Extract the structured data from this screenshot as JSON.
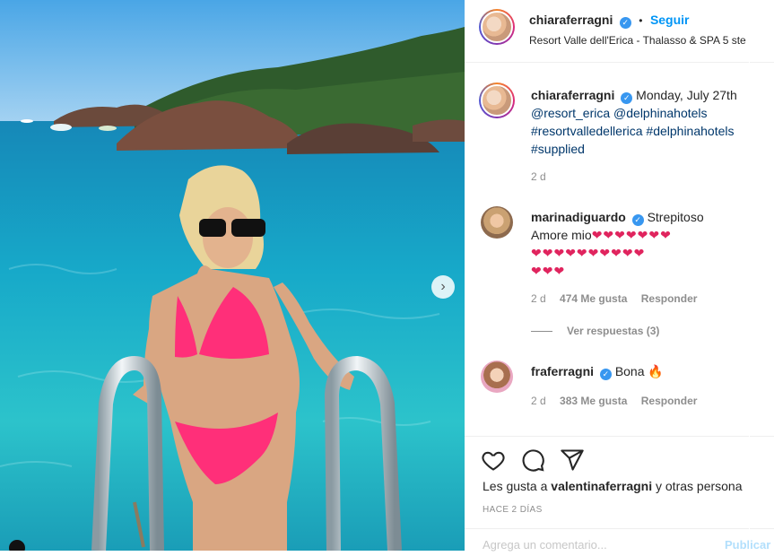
{
  "post": {
    "author": "chiaraferragni",
    "follow_label": "Seguir",
    "separator": "•",
    "location": "Resort Valle dell'Erica - Thalasso & SPA 5 ste",
    "verified_mark": "✓"
  },
  "caption": {
    "author": "chiaraferragni",
    "text": "Monday, July 27th",
    "mentions": [
      "@resort_erica",
      "@delphinahotels"
    ],
    "hashtags_line1": [
      "#resortvalledellerica",
      "#delphinahotels"
    ],
    "hashtags_line2": [
      "#supplied"
    ],
    "time": "2 d"
  },
  "comments": [
    {
      "author": "marinadiguardo",
      "line1": "Strepitoso",
      "line2": "Amore mio",
      "hearts_row1": "❤❤❤❤❤❤❤",
      "hearts_row2": "❤❤❤❤❤❤❤❤❤❤",
      "hearts_row3": "❤❤❤",
      "time": "2 d",
      "likes": "474 Me gusta",
      "reply_label": "Responder"
    },
    {
      "author": "fraferragni",
      "text": "Bona 🔥",
      "time": "2 d",
      "likes": "383 Me gusta",
      "reply_label": "Responder"
    }
  ],
  "view_replies": "Ver respuestas (3)",
  "likes_summary": {
    "prefix": "Les gusta a",
    "user": "valentinaferragni",
    "suffix": "y otras persona"
  },
  "ago": "HACE 2 DÍAS",
  "add_comment": {
    "placeholder": "Agrega un comentario...",
    "post_label": "Publicar"
  },
  "icons": [
    "heart-icon",
    "comment-icon",
    "share-icon",
    "next-arrow-icon",
    "verified-icon"
  ],
  "colors": {
    "link": "#00376b",
    "follow": "#0095f6",
    "verified": "#3897f0",
    "meta": "#8e8e8e"
  }
}
